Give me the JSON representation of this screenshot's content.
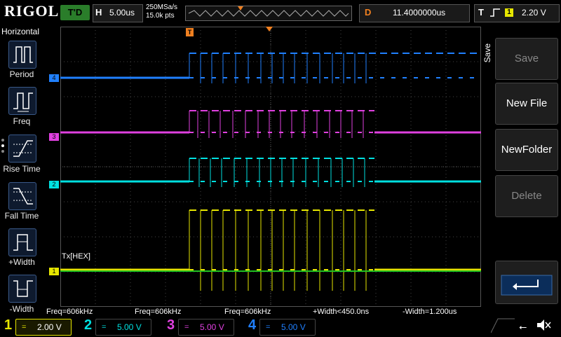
{
  "header": {
    "logo": "RIGOL",
    "run_status": "T'D",
    "timebase_label": "H",
    "timebase_value": "5.00us",
    "sample_rate": "250MSa/s",
    "memory_depth": "15.0k pts",
    "delay_label": "D",
    "delay_value": "11.4000000us",
    "trigger_label": "T",
    "trigger_channel": "1",
    "trigger_level": "2.20 V"
  },
  "left_menu": {
    "title": "Horizontal",
    "items": [
      {
        "label": "Period"
      },
      {
        "label": "Freq"
      },
      {
        "label": "Rise Time"
      },
      {
        "label": "Fall Time"
      },
      {
        "label": "+Width"
      },
      {
        "label": "-Width"
      }
    ]
  },
  "right_menu": {
    "side_label": "Save",
    "items": [
      {
        "label": "Save",
        "enabled": false
      },
      {
        "label": "New File",
        "enabled": true
      },
      {
        "label": "NewFolder",
        "enabled": true
      },
      {
        "label": "Delete",
        "enabled": false
      }
    ]
  },
  "waveform": {
    "decode_label": "Tx[HEX]",
    "channel_markers": [
      "4",
      "3",
      "2",
      "1"
    ],
    "trigger_marker": "T"
  },
  "measurements": [
    {
      "text": "Freq=606kHz",
      "color": "#3aa0ff"
    },
    {
      "text": "Freq=606kHz",
      "color": "#ff40ff"
    },
    {
      "text": "Freq=606kHz",
      "color": "#40e0ff"
    },
    {
      "text": "+Width<450.0ns",
      "color": "#e6e600"
    },
    {
      "text": "-Width=1.200us",
      "color": "#e6e600"
    }
  ],
  "channels": [
    {
      "num": "1",
      "scale": "2.00 V",
      "color": "#e6e600"
    },
    {
      "num": "2",
      "scale": "5.00 V",
      "color": "#00e0e0"
    },
    {
      "num": "3",
      "scale": "5.00 V",
      "color": "#e040e0"
    },
    {
      "num": "4",
      "scale": "5.00 V",
      "color": "#2080ff"
    }
  ],
  "colors": {
    "ch1": "#e6e600",
    "ch2": "#00e0e0",
    "ch3": "#e040e0",
    "ch4": "#2080ff",
    "trigger": "#f08020",
    "decode_line": "#20c020"
  }
}
